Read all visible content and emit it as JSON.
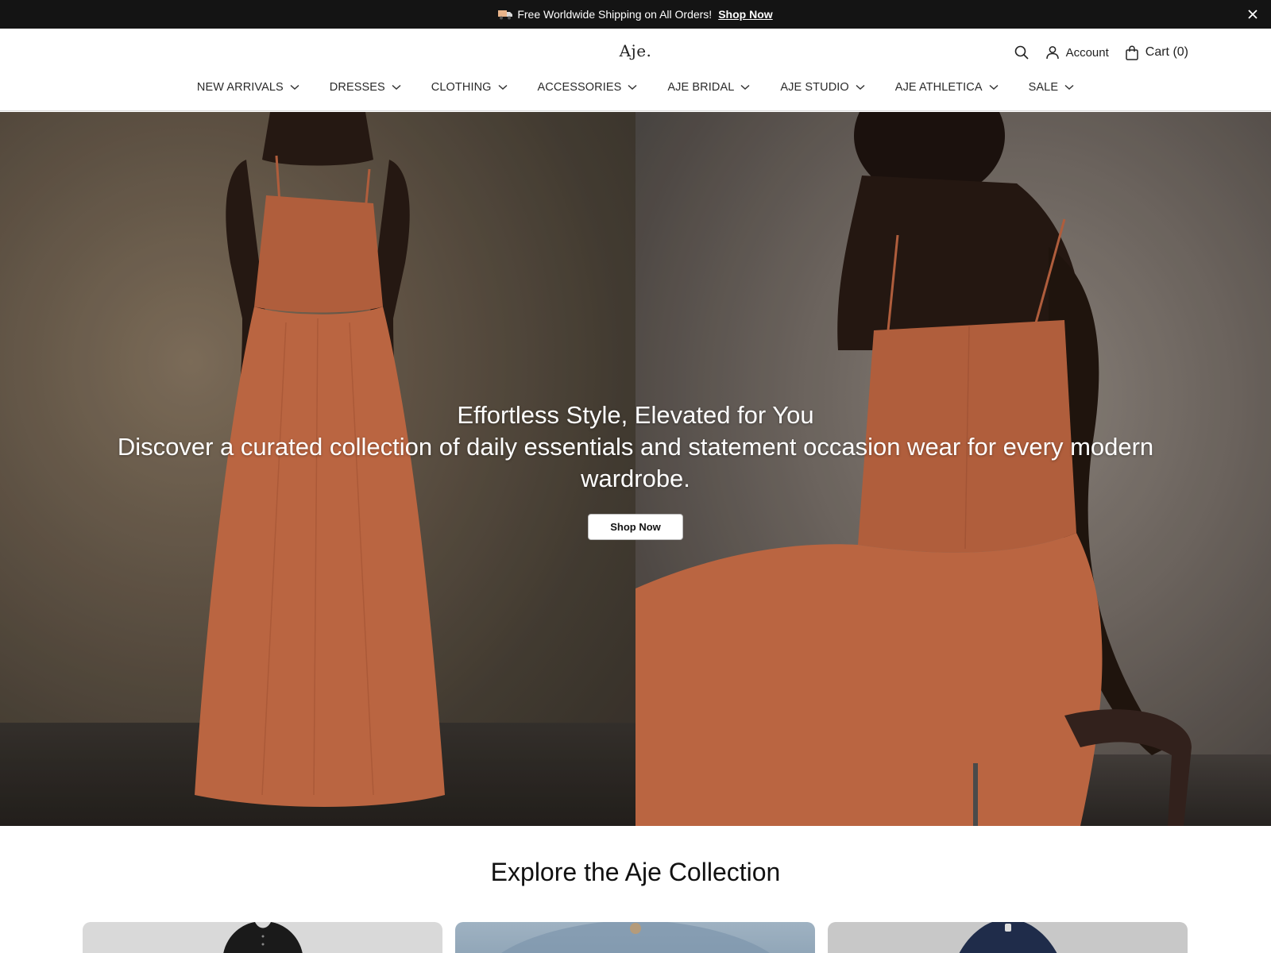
{
  "announcement": {
    "text": "Free Worldwide Shipping on All Orders!",
    "link": "Shop Now",
    "icons": {
      "truck": "truck-icon",
      "close": "close-icon"
    }
  },
  "header": {
    "logo": "Aje.",
    "account_label": "Account",
    "cart_label": "Cart (0)",
    "icons": {
      "search": "search-icon",
      "account": "user-icon",
      "cart": "shopping-bag-icon"
    }
  },
  "nav": {
    "items": [
      {
        "label": "NEW ARRIVALS"
      },
      {
        "label": "DRESSES"
      },
      {
        "label": "CLOTHING"
      },
      {
        "label": "ACCESSORIES"
      },
      {
        "label": "AJE BRIDAL"
      },
      {
        "label": "AJE STUDIO"
      },
      {
        "label": "AJE ATHLETICA"
      },
      {
        "label": "SALE"
      }
    ]
  },
  "hero": {
    "title": "Effortless Style, Elevated for You",
    "subtitle": "Discover a curated collection of daily essentials and statement occasion wear for every modern wardrobe.",
    "button": "Shop Now",
    "colors": {
      "dress": "#d9774f",
      "text": "#ffffff"
    }
  },
  "collection": {
    "title": "Explore the Aje Collection",
    "cards": [
      {
        "name": "black sheer top"
      },
      {
        "name": "denim jacket"
      },
      {
        "name": "dark denim jacket"
      }
    ]
  }
}
